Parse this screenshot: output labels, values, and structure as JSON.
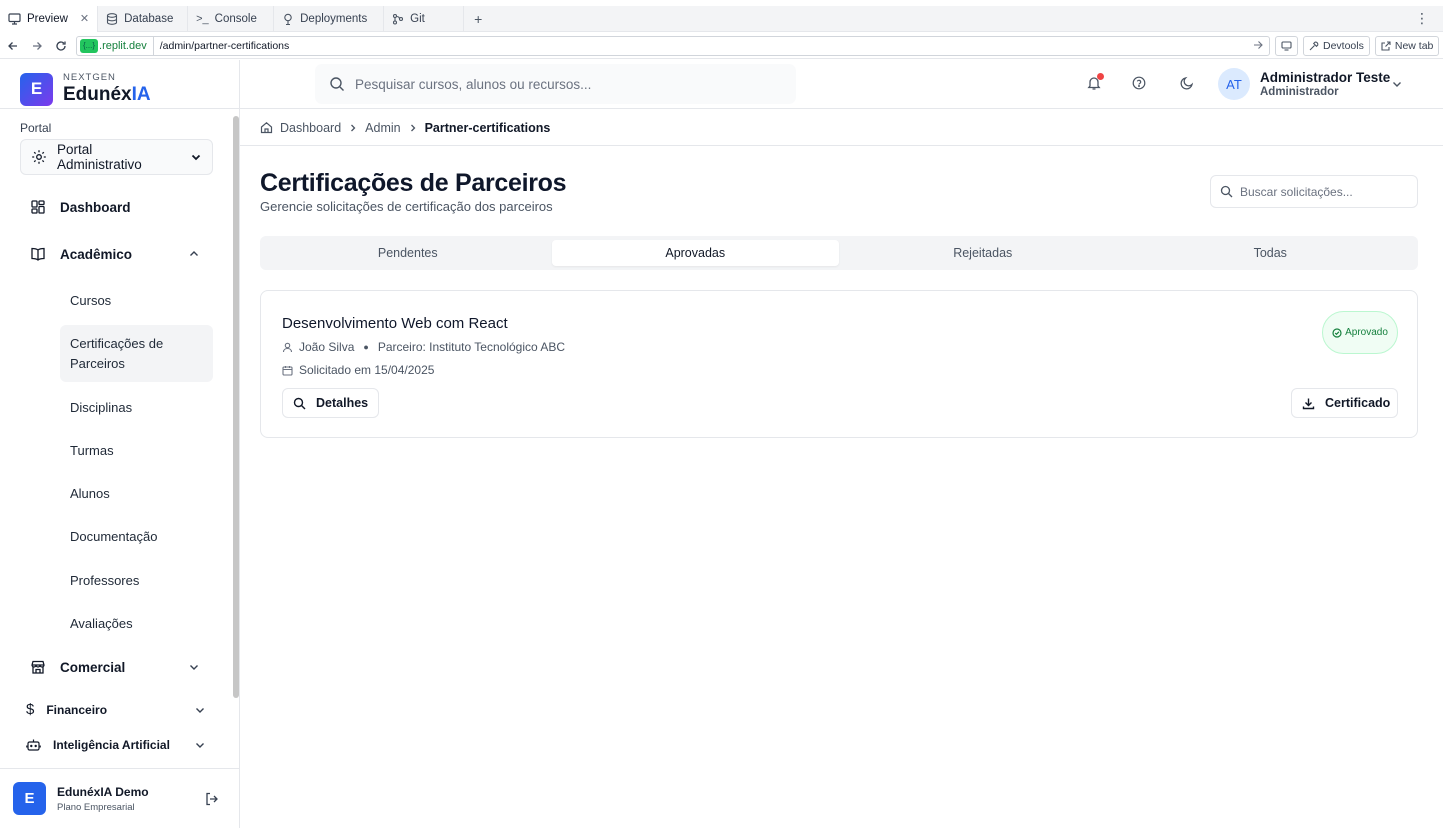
{
  "browser": {
    "tabs": [
      {
        "label": "Preview",
        "icon": "monitor-icon"
      },
      {
        "label": "Database",
        "icon": "database-icon"
      },
      {
        "label": "Console",
        "icon": "terminal-icon"
      },
      {
        "label": "Deployments",
        "icon": "deploy-icon"
      },
      {
        "label": "Git",
        "icon": "git-icon"
      }
    ],
    "url_host": ".replit.dev",
    "url_host_pill": "{...}",
    "url_path": "/admin/partner-certifications",
    "devtools_label": "Devtools",
    "newtab_label": "New tab"
  },
  "brand": {
    "logo_letter": "E",
    "small": "NEXTGEN",
    "name_main": "Edunéx",
    "name_accent": "IA"
  },
  "sidebar": {
    "portal_label": "Portal",
    "portal_value": "Portal Administrativo",
    "dashboard": "Dashboard",
    "academic": "Acadêmico",
    "academic_items": [
      "Cursos",
      "Certificações de Parceiros",
      "Disciplinas",
      "Turmas",
      "Alunos",
      "Documentação",
      "Professores",
      "Avaliações"
    ],
    "commercial": "Comercial",
    "financial": "Financeiro",
    "ai": "Inteligência Artificial",
    "footer": {
      "avatar": "E",
      "name": "EdunéxIA Demo",
      "plan": "Plano Empresarial"
    }
  },
  "header": {
    "search_placeholder": "Pesquisar cursos, alunos ou recursos...",
    "user_initials": "AT",
    "user_name": "Administrador Teste",
    "user_role": "Administrador"
  },
  "breadcrumb": [
    "Dashboard",
    "Admin",
    "Partner-certifications"
  ],
  "page": {
    "title": "Certificações de Parceiros",
    "subtitle": "Gerencie solicitações de certificação dos parceiros",
    "search_placeholder": "Buscar solicitações...",
    "tabs": [
      "Pendentes",
      "Aprovadas",
      "Rejeitadas",
      "Todas"
    ],
    "active_tab": "Aprovadas"
  },
  "request": {
    "course": "Desenvolvimento Web com React",
    "student": "João Silva",
    "partner": "Parceiro: Instituto Tecnológico ABC",
    "requested": "Solicitado em 15/04/2025",
    "status": "Aprovado",
    "status_color": "#15803d",
    "details_label": "Detalhes",
    "certificate_label": "Certificado"
  },
  "colors": {
    "accent": "#2563eb",
    "notification": "#ef4444"
  }
}
